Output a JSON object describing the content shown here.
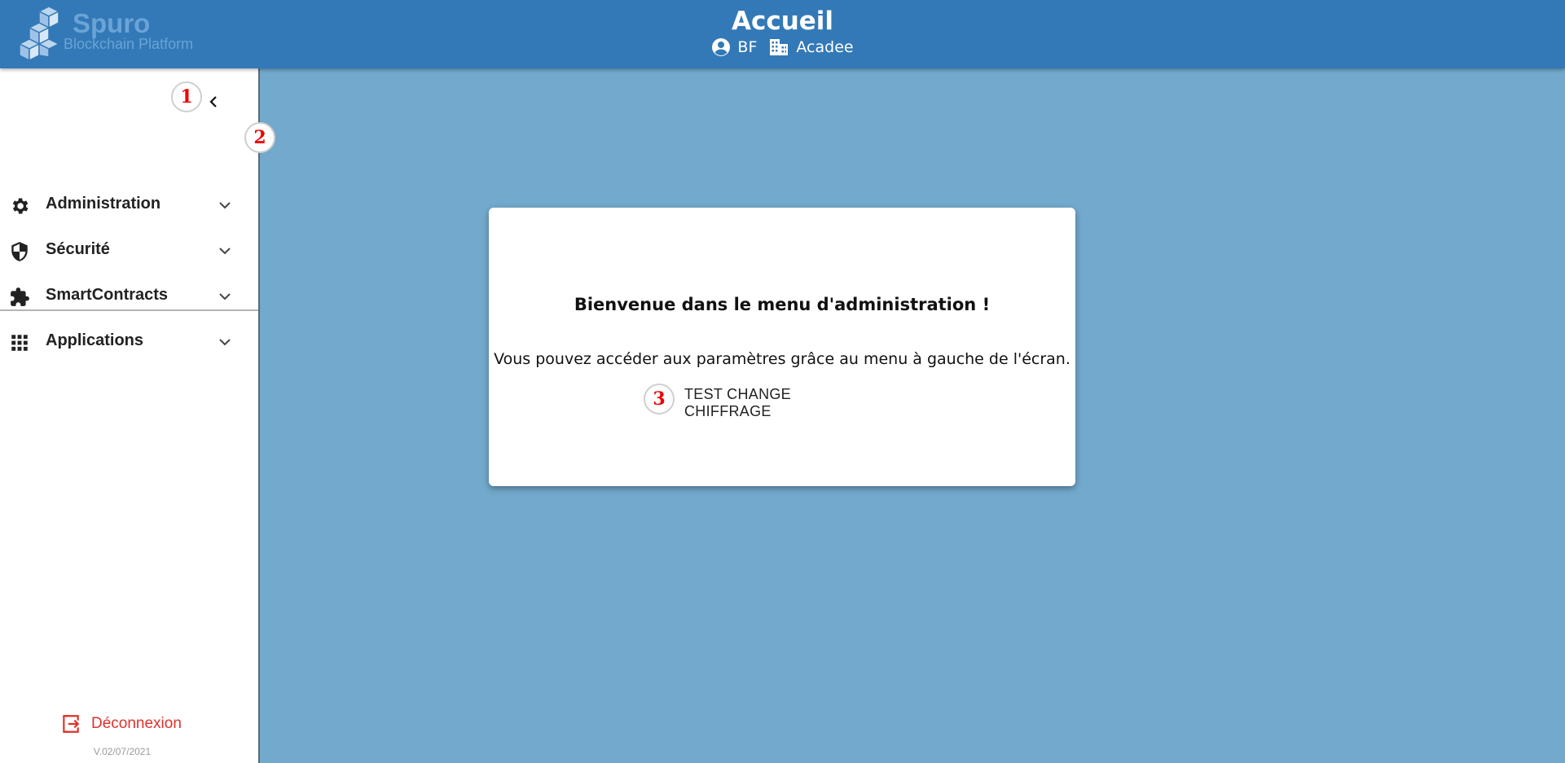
{
  "header": {
    "brand_name": "Spuro",
    "brand_sub": "Blockchain Platform",
    "title": "Accueil",
    "user": "BF",
    "organization": "Acadee"
  },
  "sidebar": {
    "items": [
      {
        "label": "Administration",
        "icon": "gear-icon"
      },
      {
        "label": "Sécurité",
        "icon": "shield-icon"
      },
      {
        "label": "SmartContracts",
        "icon": "puzzle-icon"
      },
      {
        "label": "Applications",
        "icon": "apps-grid-icon"
      }
    ],
    "logout_label": "Déconnexion",
    "version": "V.02/07/2021"
  },
  "main": {
    "card": {
      "title": "Bienvenue dans le menu d'administration !",
      "text": "Vous pouvez accéder aux paramètres grâce au menu à gauche de l'écran.",
      "button_label": "TEST CHANGE CHIFFRAGE"
    }
  },
  "markers": [
    "1",
    "2",
    "3"
  ],
  "colors": {
    "header_bg": "#3379b7",
    "main_bg": "#72a9cc",
    "logout": "#e0312b",
    "marker": "#e00000"
  }
}
